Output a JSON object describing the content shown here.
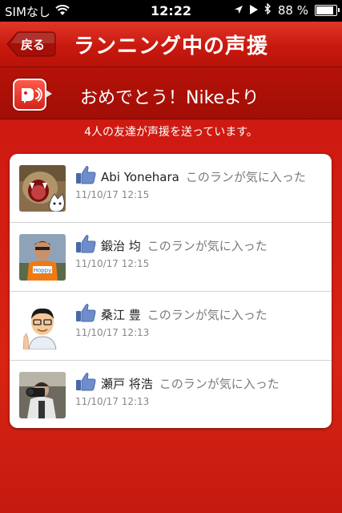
{
  "status": {
    "carrier": "SIMなし",
    "time": "12:22",
    "battery": "88 %"
  },
  "nav": {
    "back_label": "戻る",
    "title": "ランニング中の声援"
  },
  "banner": {
    "text": "おめでとう！Nikeより"
  },
  "subtitle": "4人の友達が声援を送っています。",
  "cheers": [
    {
      "name": "Abi Yonehara",
      "message": "このランが気に入った",
      "date": "11/10/17",
      "time": "12:15",
      "avatar": "cat-avatar"
    },
    {
      "name": "鍛治 均",
      "message": "このランが気に入った",
      "date": "11/10/17",
      "time": "12:15",
      "avatar": "runner-avatar"
    },
    {
      "name": "桑江 豊",
      "message": "このランが気に入った",
      "date": "11/10/17",
      "time": "12:13",
      "avatar": "cartoon-avatar"
    },
    {
      "name": "瀬戸 将浩",
      "message": "このランが気に入った",
      "date": "11/10/17",
      "time": "12:13",
      "avatar": "camera-avatar"
    }
  ],
  "colors": {
    "accent": "#c81410",
    "like_blue": "#5b7bbf"
  }
}
